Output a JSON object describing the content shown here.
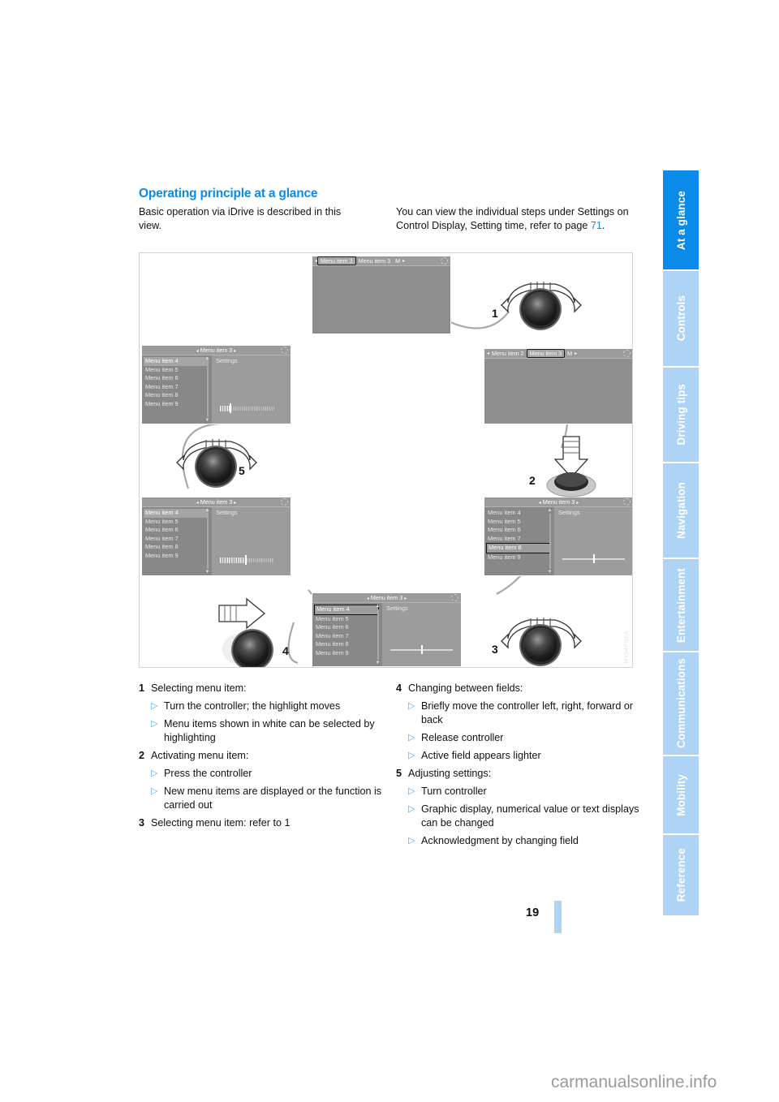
{
  "document": {
    "title": "Operating principle at a glance",
    "page_number": "19",
    "watermark": "carmanualsonline.info",
    "figure_id": "MY04PNEA"
  },
  "intro": {
    "left": "Basic operation via iDrive is described in this view.",
    "right_before": "You can view the individual steps under Settings on Control Display, Setting time, refer to page ",
    "right_link": "71",
    "right_after": "."
  },
  "sidebar": {
    "tabs": [
      {
        "label": "At a glance",
        "active": true
      },
      {
        "label": "Controls",
        "active": false
      },
      {
        "label": "Driving tips",
        "active": false
      },
      {
        "label": "Navigation",
        "active": false
      },
      {
        "label": "Entertainment",
        "active": false
      },
      {
        "label": "Communications",
        "active": false
      },
      {
        "label": "Mobility",
        "active": false
      },
      {
        "label": "Reference",
        "active": false
      }
    ],
    "active_color": "#0c8ae8",
    "inactive_color": "#aed3f5"
  },
  "figure": {
    "screens": {
      "top_center": {
        "header_tabs": [
          "Menu item 2",
          "Menu item 3",
          "M"
        ],
        "selected_tab": "Menu item 2"
      },
      "right_top": {
        "header_tabs": [
          "Menu item 2",
          "Menu item 3",
          "M"
        ],
        "selected_tab": "Menu item 3"
      },
      "left_top": {
        "header": "Menu item 3",
        "list": [
          "Menu item 4",
          "Menu item 5",
          "Menu item 6",
          "Menu item 7",
          "Menu item 8",
          "Menu item 9"
        ],
        "highlighted": "Menu item 4",
        "right_title": "Settings",
        "widget": "bar-graphic"
      },
      "left_bottom": {
        "header": "Menu item 3",
        "list": [
          "Menu item 4",
          "Menu item 5",
          "Menu item 6",
          "Menu item 7",
          "Menu item 8",
          "Menu item 9"
        ],
        "highlighted": "Menu item 4",
        "right_title": "Settings",
        "widget": "bar-graphic"
      },
      "right_bottom": {
        "header": "Menu item 3",
        "list": [
          "Menu item 4",
          "Menu item 5",
          "Menu item 6",
          "Menu item 7",
          "Menu item 8",
          "Menu item 9"
        ],
        "boxed": "Menu item 8",
        "right_title": "Settings",
        "widget": "slider-graphic"
      },
      "bottom_center": {
        "header": "Menu item 3",
        "list": [
          "Menu item 4",
          "Menu item 5",
          "Menu item 6",
          "Menu item 7",
          "Menu item 8",
          "Menu item 9"
        ],
        "boxed": "Menu item 4",
        "right_title": "Settings",
        "widget": "slider-graphic"
      }
    },
    "callouts": [
      {
        "number": "1",
        "action": "turn"
      },
      {
        "number": "2",
        "action": "press"
      },
      {
        "number": "3",
        "action": "turn"
      },
      {
        "number": "4",
        "action": "move"
      },
      {
        "number": "5",
        "action": "turn"
      }
    ]
  },
  "steps_left": [
    {
      "num": "1",
      "text": "Selecting menu item:",
      "subs": [
        "Turn the controller; the highlight moves",
        "Menu items shown in white can be selected by highlighting"
      ]
    },
    {
      "num": "2",
      "text": "Activating menu item:",
      "subs": [
        "Press the controller",
        "New menu items are displayed or the function is carried out"
      ]
    },
    {
      "num": "3",
      "text": "Selecting menu item: refer to 1",
      "subs": []
    }
  ],
  "steps_right": [
    {
      "num": "4",
      "text": "Changing between fields:",
      "subs": [
        "Briefly move the controller left, right, forward or back",
        "Release controller",
        "Active field appears lighter"
      ]
    },
    {
      "num": "5",
      "text": "Adjusting settings:",
      "subs": [
        "Turn controller",
        "Graphic display, numerical value or text displays can be changed",
        "Acknowledgment by changing field"
      ]
    }
  ]
}
